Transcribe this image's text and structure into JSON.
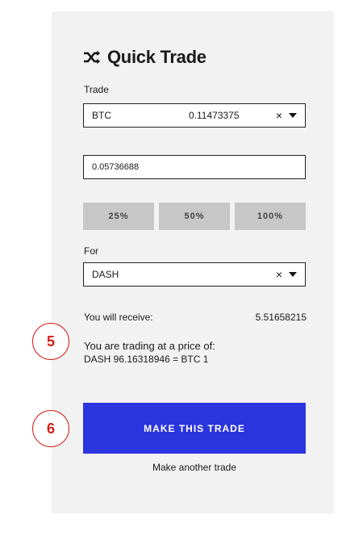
{
  "header": {
    "title": "Quick Trade",
    "icon": "shuffle-icon"
  },
  "trade": {
    "label": "Trade",
    "currency": "BTC",
    "balance": "0.11473375",
    "clear_symbol": "×",
    "amount_value": "0.05736688"
  },
  "percent_buttons": [
    "25%",
    "50%",
    "100%"
  ],
  "for": {
    "label": "For",
    "currency": "DASH",
    "clear_symbol": "×"
  },
  "summary": {
    "receive_label": "You will receive:",
    "receive_value": "5.51658215",
    "price_label": "You are trading at a price of:",
    "price_value": "DASH 96.16318946 = BTC 1"
  },
  "actions": {
    "make_trade": "MAKE THIS TRADE",
    "another_trade": "Make another trade"
  },
  "annotations": {
    "step_5": "5",
    "step_6": "6",
    "color": "#d0201a"
  },
  "colors": {
    "accent": "#2b35e0",
    "panel": "#f2f2f2",
    "percent_button": "#c7c7c7"
  }
}
